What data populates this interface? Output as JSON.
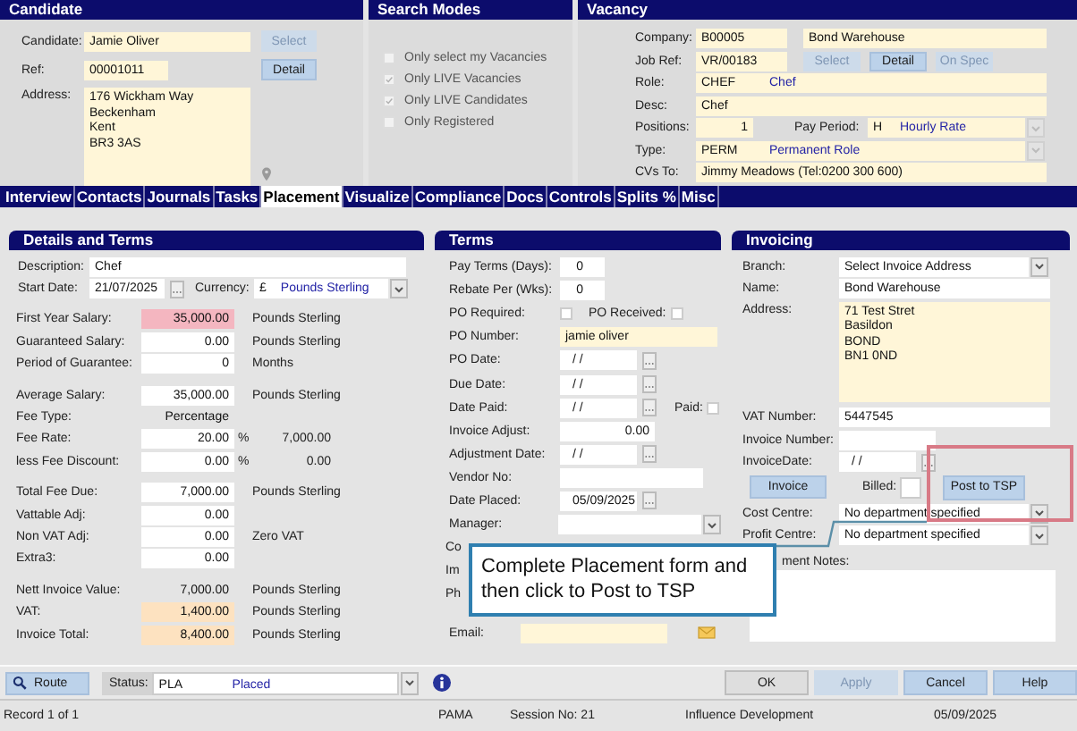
{
  "candidate_panel": {
    "title": "Candidate",
    "candidate_label": "Candidate:",
    "candidate": "Jamie Oliver",
    "select_button": {
      "label": "Select",
      "disabled": true
    },
    "ref_label": "Ref:",
    "ref": "00001011",
    "detail_button": {
      "label": "Detail",
      "disabled": false
    },
    "address_label": "Address:",
    "address": [
      "176 Wickham Way",
      "Beckenham",
      "Kent",
      "BR3 3AS"
    ]
  },
  "search_modes": {
    "title": "Search Modes",
    "options": [
      {
        "label": "Only select my Vacancies",
        "checked": false,
        "disabled": true
      },
      {
        "label": "Only LIVE Vacancies",
        "checked": true,
        "disabled": true
      },
      {
        "label": "Only LIVE Candidates",
        "checked": true,
        "disabled": true
      },
      {
        "label": "Only Registered",
        "checked": false,
        "disabled": true
      }
    ]
  },
  "vacancy": {
    "title": "Vacancy",
    "company_label": "Company:",
    "company_code": "B00005",
    "company_name": "Bond Warehouse",
    "job_ref_label": "Job Ref:",
    "job_ref": "VR/00183",
    "buttons": [
      {
        "label": "Select",
        "disabled": true
      },
      {
        "label": "Detail",
        "disabled": false
      },
      {
        "label": "On Spec",
        "disabled": true
      }
    ],
    "role_label": "Role:",
    "role_code": "CHEF",
    "role_name": "Chef",
    "desc_label": "Desc:",
    "desc": "Chef",
    "positions_label": "Positions:",
    "positions": "1",
    "pay_period_label": "Pay Period:",
    "pay_period_code": "H",
    "pay_period_name": "Hourly Rate",
    "type_label": "Type:",
    "type_code": "PERM",
    "type_name": "Permanent Role",
    "cvs_to_label": "CVs To:",
    "cvs_to": "Jimmy Meadows (Tel:0200 300 600)"
  },
  "tabs": [
    {
      "label": "Interview",
      "selected": false
    },
    {
      "label": "Contacts",
      "selected": false
    },
    {
      "label": "Journals",
      "selected": false
    },
    {
      "label": "Tasks",
      "selected": false
    },
    {
      "label": "Placement",
      "selected": true
    },
    {
      "label": "Visualize",
      "selected": false
    },
    {
      "label": "Compliance",
      "selected": false
    },
    {
      "label": "Docs",
      "selected": false
    },
    {
      "label": "Controls",
      "selected": false
    },
    {
      "label": "Splits %",
      "selected": false
    },
    {
      "label": "Misc",
      "selected": false
    }
  ],
  "details": {
    "title": "Details and Terms",
    "description_label": "Description:",
    "description": "Chef",
    "start_date_label": "Start Date:",
    "start_date": "21/07/2025",
    "currency_label": "Currency:",
    "currency_symbol": "£",
    "currency_name": "Pounds Sterling",
    "groups": [
      [
        {
          "label": "First Year Salary:",
          "value": "35,000.00",
          "color": "#f4b6c0",
          "unit": "Pounds Sterling"
        },
        {
          "label": "Guaranteed Salary:",
          "value": "0.00",
          "color": "#ffffff",
          "unit": "Pounds Sterling"
        },
        {
          "label": "Period of Guarantee:",
          "value": "0",
          "color": "#ffffff",
          "unit": "Months"
        }
      ],
      [
        {
          "label": "Average Salary:",
          "value": "35,000.00",
          "color": "#ffffff",
          "unit": "Pounds Sterling"
        },
        {
          "label": "Fee Type:",
          "value": "Percentage"
        },
        {
          "label": "Fee Rate:",
          "value": "20.00",
          "color": "#ffffff",
          "percent": "%",
          "amount": "7,000.00"
        },
        {
          "label": "less Fee Discount:",
          "value": "0.00",
          "color": "#ffffff",
          "percent": "%",
          "amount": "0.00"
        }
      ],
      [
        {
          "label": "Total Fee Due:",
          "value": "7,000.00",
          "color": "#ffffff",
          "unit": "Pounds Sterling"
        },
        {
          "label": "Vattable Adj:",
          "value": "0.00",
          "color": "#ffffff"
        },
        {
          "label": "Non VAT Adj:",
          "value": "0.00",
          "color": "#ffffff",
          "unit": "Zero VAT"
        },
        {
          "label": "Extra3:",
          "value": "0.00",
          "color": "#ffffff"
        }
      ],
      [
        {
          "label": "Nett Invoice Value:",
          "value": "7,000.00",
          "unit": "Pounds Sterling"
        },
        {
          "label": "VAT:",
          "value": "1,400.00",
          "color": "#fde2c0",
          "unit": "Pounds Sterling"
        },
        {
          "label": "Invoice Total:",
          "value": "8,400.00",
          "color": "#fde2c0",
          "unit": "Pounds Sterling"
        }
      ]
    ]
  },
  "terms": {
    "title": "Terms",
    "rows": [
      {
        "kind": "number",
        "label": "Pay Terms (Days):",
        "value": "0"
      },
      {
        "kind": "number",
        "label": "Rebate Per (Wks):",
        "value": "0"
      },
      {
        "kind": "checks",
        "label": "PO Required:",
        "checked": false,
        "label_2": "PO Received:",
        "checked_2": false
      },
      {
        "kind": "text",
        "label": "PO Number:",
        "value": "jamie oliver"
      },
      {
        "kind": "date",
        "label": "PO Date:",
        "value": "/ /"
      },
      {
        "kind": "date",
        "label": "Due Date:",
        "value": "/ /"
      },
      {
        "kind": "date",
        "label": "Date Paid:",
        "value": "/ /",
        "label_2": "Paid:",
        "checked_2": false
      },
      {
        "kind": "amount",
        "label": "Invoice Adjust:",
        "value": "0.00"
      },
      {
        "kind": "date",
        "label": "Adjustment Date:",
        "value": "/ /"
      },
      {
        "kind": "input",
        "label": "Vendor No:"
      },
      {
        "kind": "date",
        "label": "Date Placed:",
        "value": "05/09/2025"
      },
      {
        "kind": "dropdown",
        "label": "Manager:"
      },
      {
        "kind": "covered",
        "label": "Co"
      },
      {
        "kind": "covered",
        "label": "Im"
      },
      {
        "kind": "covered",
        "label": "Ph"
      },
      {
        "kind": "email",
        "label": "Email:"
      }
    ]
  },
  "invoicing": {
    "title": "Invoicing",
    "branch_label": "Branch:",
    "branch": "Select Invoice Address",
    "name_label": "Name:",
    "name": "Bond Warehouse",
    "address_label": "Address:",
    "address": [
      "71 Test Stret",
      "Basildon",
      "BOND",
      "BN1 0ND"
    ],
    "vat_label": "VAT Number:",
    "vat": "5447545",
    "invoice_number_label": "Invoice Number:",
    "invoice_date_label": "InvoiceDate:",
    "invoice_date": "/ /",
    "invoice_button": "Invoice",
    "billed_label": "Billed:",
    "billed": false,
    "post_button": "Post to TSP",
    "cost_centre_label": "Cost Centre:",
    "cost_centre": "No department specified",
    "profit_centre_label": "Profit Centre:",
    "profit_centre": "No department specified",
    "notes_label": "ment Notes:"
  },
  "callout": "Complete Placement form and then click to Post to TSP",
  "toolbar": {
    "route_button": "Route",
    "status_label": "Status:",
    "status_code": "PLA",
    "status_name": "Placed",
    "buttons": [
      {
        "label": "OK",
        "disabled": false,
        "default": true
      },
      {
        "label": "Apply",
        "disabled": true,
        "default": false
      },
      {
        "label": "Cancel",
        "disabled": false,
        "default": false
      },
      {
        "label": "Help",
        "disabled": false,
        "default": false
      }
    ]
  },
  "status_bar": [
    "Record 1 of 1",
    "PAMA",
    "Session No: 21",
    "Influence Development",
    "05/09/2025"
  ]
}
